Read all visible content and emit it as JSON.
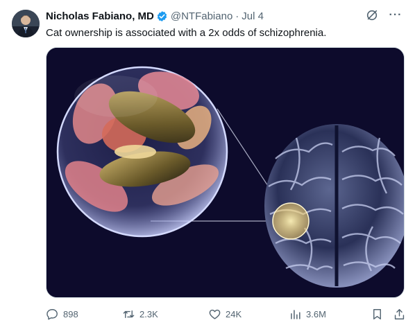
{
  "author": {
    "name": "Nicholas Fabiano, MD",
    "handle": "@NTFabiano",
    "separator": "·",
    "date": "Jul 4",
    "verified": true
  },
  "tweet": {
    "text": "Cat ownership is associated with a 2x odds of schizophrenia."
  },
  "media": {
    "subject": "brain with magnified parasite cells"
  },
  "metrics": {
    "replies": "898",
    "reposts": "2.3K",
    "likes": "24K",
    "views": "3.6M"
  },
  "top_actions": {
    "more_label": "···"
  },
  "colors": {
    "text_primary": "#0f1419",
    "text_secondary": "#536471",
    "verified_blue": "#1d9bf0",
    "media_background": "#0d0b2c"
  }
}
